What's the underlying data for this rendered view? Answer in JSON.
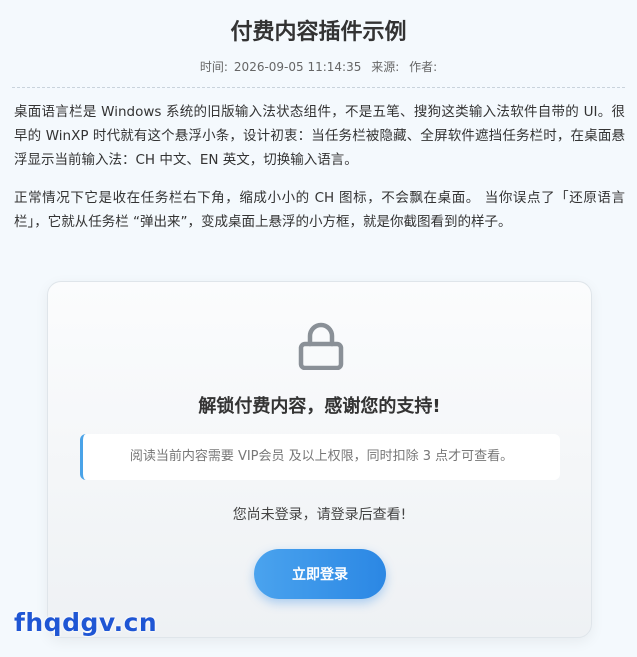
{
  "article": {
    "title": "付费内容插件示例",
    "meta": {
      "time_label": "时间:",
      "time_value": "2026-09-05 11:14:35",
      "source_label": "来源:",
      "author_label": "作者:"
    },
    "paragraphs": [
      "桌面语言栏是 Windows 系统的旧版输入法状态组件，不是五笔、搜狗这类输入法软件自带的 UI。很早的 WinXP 时代就有这个悬浮小条，设计初衷：当任务栏被隐藏、全屏软件遮挡任务栏时，在桌面悬浮显示当前输入法：CH 中文、EN 英文，切换输入语言。",
      "正常情况下它是收在任务栏右下角，缩成小小的 CH 图标，不会飘在桌面。 当你误点了「还原语言栏」，它就从任务栏 “弹出来”，变成桌面上悬浮的小方框，就是你截图看到的样子。"
    ]
  },
  "paywall": {
    "icon": "lock-icon",
    "heading": "解锁付费内容，感谢您的支持!",
    "notice": "阅读当前内容需要 VIP会员 及以上权限，同时扣除 3 点才可查看。",
    "login_hint": "您尚未登录，请登录后查看!",
    "login_button": "立即登录"
  },
  "watermark": "fhqdgv.cn",
  "colors": {
    "accent": "#2b87e4",
    "notice_border": "#4aa3e8",
    "watermark": "#1f56d4"
  }
}
